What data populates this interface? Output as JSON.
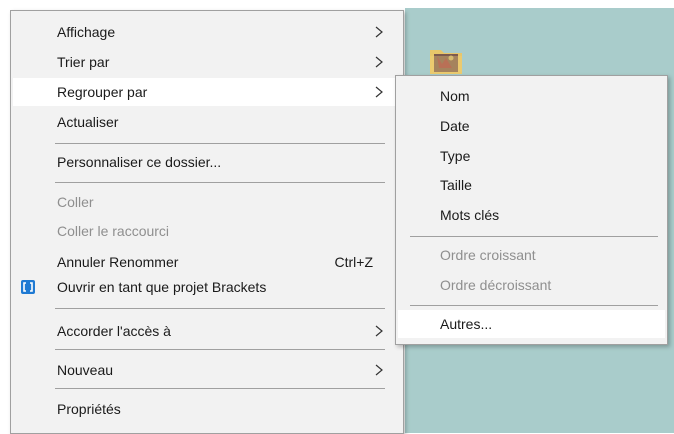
{
  "context_menu": {
    "items": [
      {
        "label": "Affichage"
      },
      {
        "label": "Trier par"
      },
      {
        "label": "Regrouper par"
      },
      {
        "label": "Actualiser"
      },
      {
        "label": "Personnaliser ce dossier..."
      },
      {
        "label": "Coller"
      },
      {
        "label": "Coller le raccourci"
      },
      {
        "label": "Annuler Renommer",
        "shortcut": "Ctrl+Z"
      },
      {
        "label": "Ouvrir en tant que projet Brackets"
      },
      {
        "label": "Accorder l'accès à"
      },
      {
        "label": "Nouveau"
      },
      {
        "label": "Propriétés"
      }
    ]
  },
  "submenu": {
    "items": [
      {
        "label": "Nom"
      },
      {
        "label": "Date"
      },
      {
        "label": "Type"
      },
      {
        "label": "Taille"
      },
      {
        "label": "Mots clés"
      },
      {
        "label": "Ordre croissant"
      },
      {
        "label": "Ordre décroissant"
      },
      {
        "label": "Autres..."
      }
    ]
  },
  "colors": {
    "menu_bg": "#f2f2f2",
    "hover_bg": "#ffffff",
    "disabled_text": "#8f8f8f",
    "desktop_bg": "#a9cccb",
    "brackets_blue": "#1f7ad3"
  }
}
